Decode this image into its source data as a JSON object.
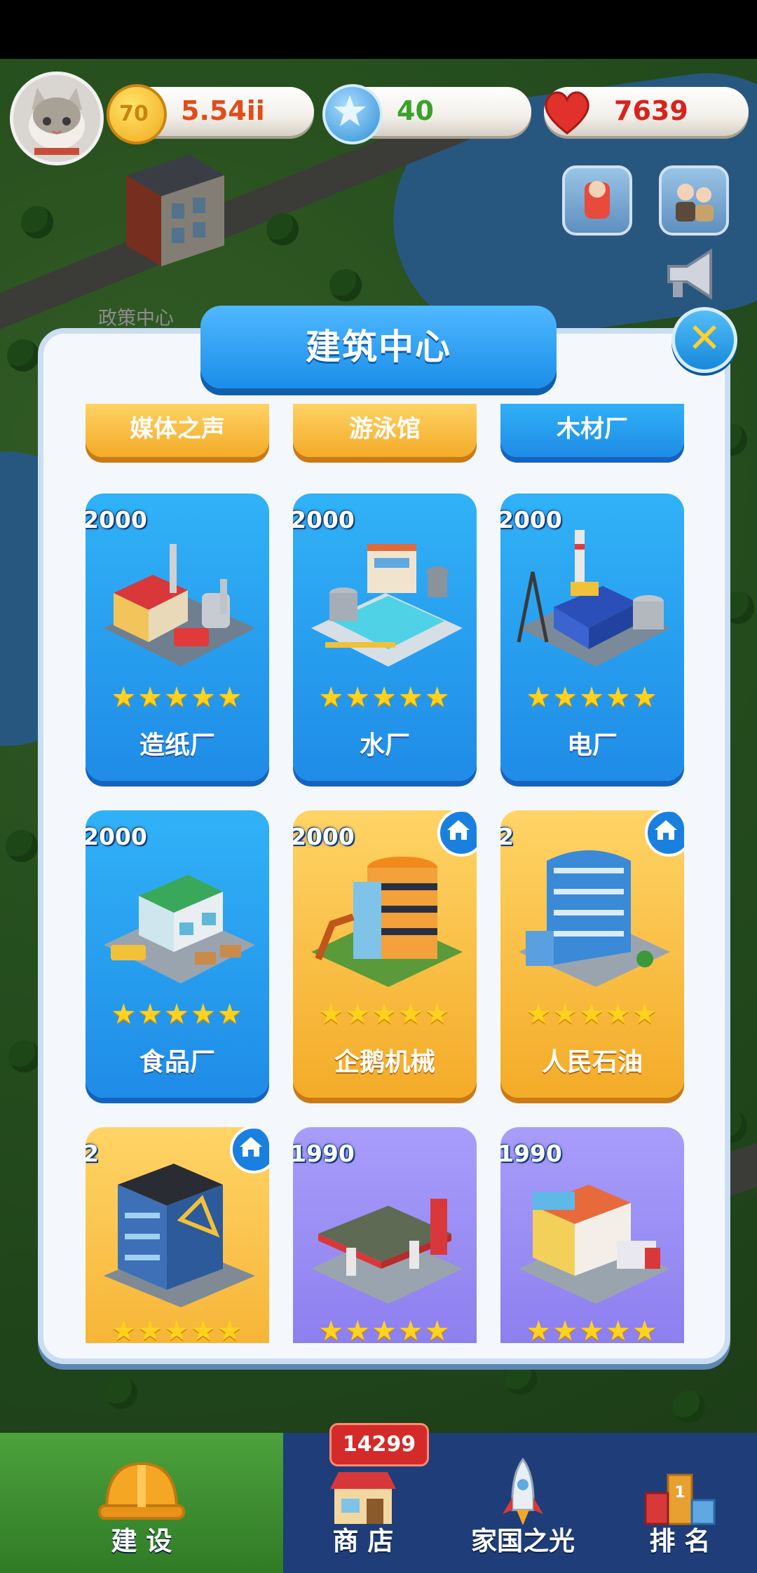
{
  "status_bar": {},
  "map": {
    "policy_center_label": "政策中心"
  },
  "top_bar": {
    "coins": "5.54ii",
    "gems": "40",
    "hearts": "7639",
    "colors": {
      "coin": "#ffc52c",
      "gem": "#3aa2e8",
      "heart": "#e0312b",
      "coin_text": "#e14c1a",
      "gem_text": "#3aa22a",
      "heart_text": "#d8231d"
    }
  },
  "dialog": {
    "title": "建筑中心",
    "close_icon": "close-icon",
    "partial_row": [
      "媒体之声",
      "游泳馆",
      "木材厂"
    ],
    "buildings": [
      {
        "price": "2000",
        "name": "造纸厂",
        "stars": "★★★★★",
        "theme": "blue",
        "owned": false
      },
      {
        "price": "2000",
        "name": "水厂",
        "stars": "★★★★★",
        "theme": "blue",
        "owned": false
      },
      {
        "price": "2000",
        "name": "电厂",
        "stars": "★★★★★",
        "theme": "blue",
        "owned": false
      },
      {
        "price": "2000",
        "name": "食品厂",
        "stars": "★★★★★",
        "theme": "blue",
        "owned": false
      },
      {
        "price": "2000",
        "name": "企鹅机械",
        "stars": "★★★★★",
        "theme": "gold",
        "owned": true
      },
      {
        "price": "2",
        "name": "人民石油",
        "stars": "★★★★★",
        "theme": "gold",
        "owned": true
      },
      {
        "price": "2",
        "name": "",
        "stars": "★★★★★",
        "theme": "gold",
        "owned": true
      },
      {
        "price": "1990",
        "name": "",
        "stars": "★★★★★",
        "theme": "purple",
        "owned": false
      },
      {
        "price": "1990",
        "name": "",
        "stars": "★★★★★",
        "theme": "purple",
        "owned": false
      }
    ]
  },
  "bottom_nav": {
    "items": [
      {
        "label": "建 设",
        "icon": "hard-hat-icon"
      },
      {
        "label": "商 店",
        "icon": "shop-icon"
      },
      {
        "label": "家国之光",
        "icon": "rocket-icon"
      },
      {
        "label": "排 名",
        "icon": "podium-icon"
      }
    ],
    "shop_badge": "14299"
  }
}
